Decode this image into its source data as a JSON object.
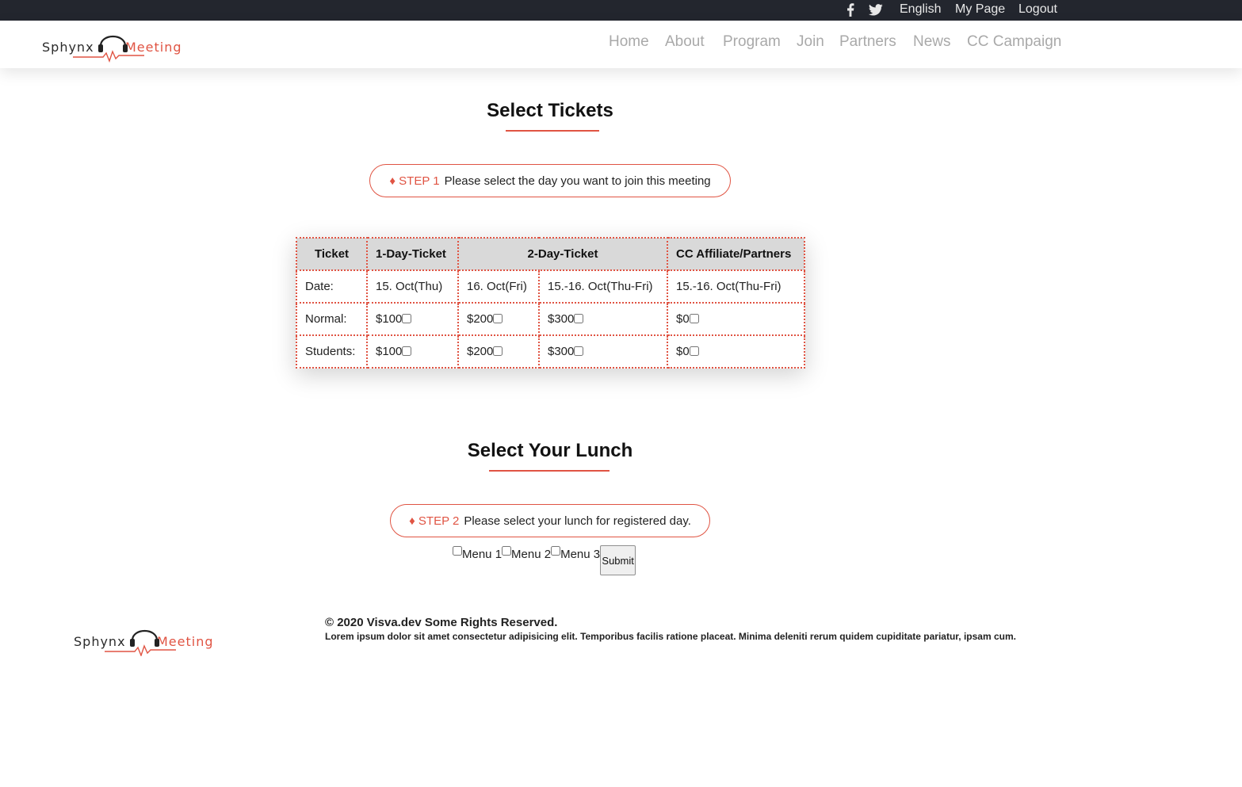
{
  "topbar": {
    "facebook_icon": "facebook-icon",
    "twitter_icon": "twitter-icon",
    "language": "English",
    "my_page": "My Page",
    "logout": "Logout"
  },
  "logo": {
    "left": "Sphynx",
    "right": "Meeting"
  },
  "nav": {
    "items": [
      "Home",
      "About",
      "Program",
      "Join",
      "Partners",
      "News",
      "CC Campaign"
    ]
  },
  "tickets": {
    "title": "Select Tickets",
    "step_label": "♦ STEP 1",
    "step_text": "Please select the day you want to join this meeting",
    "table": {
      "headers": [
        "Ticket",
        "1-Day-Ticket",
        "2-Day-Ticket",
        "CC Affiliate/Partners"
      ],
      "date_row": [
        "Date:",
        "15. Oct(Thu)",
        "16. Oct(Fri)",
        "15.-16. Oct(Thu-Fri)",
        "15.-16. Oct(Thu-Fri)"
      ],
      "normal_row": [
        "Normal:",
        "$100",
        "$200",
        "$300",
        "$0"
      ],
      "students_row": [
        "Students:",
        "$100",
        "$200",
        "$300",
        "$0"
      ]
    }
  },
  "lunch": {
    "title": "Select Your Lunch",
    "step_label": "♦ STEP 2",
    "step_text": "Please select your lunch for registered day.",
    "menus": [
      "Menu 1",
      "Menu 2",
      "Menu 3"
    ],
    "submit_label": "Submit"
  },
  "footer": {
    "copyright": "© 2020 Visva.dev Some Rights Reserved.",
    "description": "Lorem ipsum dolor sit amet consectetur adipisicing elit. Temporibus facilis ratione placeat. Minima deleniti rerum quidem cupiditate pariatur, ipsam cum."
  },
  "colors": {
    "accent": "#e05443",
    "topbar": "#23262e",
    "nav_text": "#a9a9a9",
    "table_header": "#d9d9d9"
  }
}
